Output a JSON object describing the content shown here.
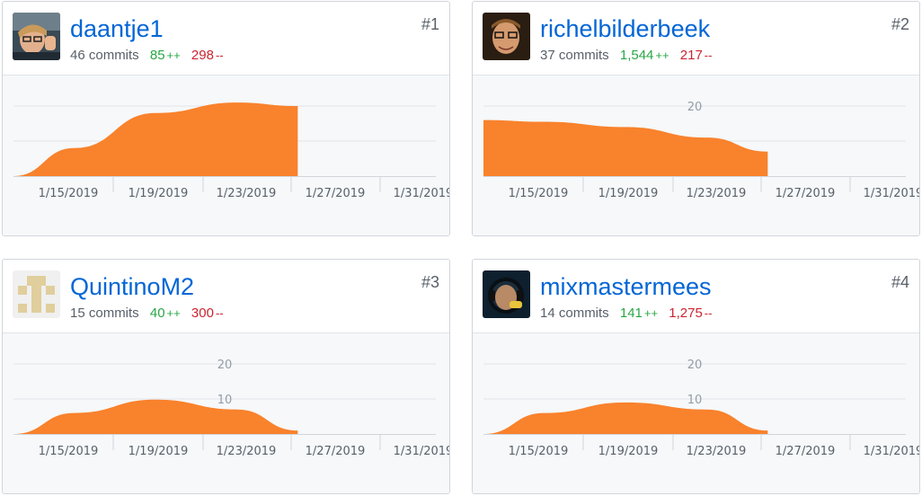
{
  "accent_color": "#f9822c",
  "x_axis_ticks": [
    "1/15/2019",
    "1/19/2019",
    "1/23/2019",
    "1/27/2019",
    "1/31/2019"
  ],
  "contributors": [
    {
      "rank": "#1",
      "username": "daantje1",
      "commits": "46 commits",
      "additions": "85",
      "deletions": "298",
      "add_suffix": "++",
      "del_suffix": "--",
      "avatar": "daantje1-avatar"
    },
    {
      "rank": "#2",
      "username": "richelbilderbeek",
      "commits": "37 commits",
      "additions": "1,544",
      "deletions": "217",
      "add_suffix": "++",
      "del_suffix": "--",
      "avatar": "richelbilderbeek-avatar"
    },
    {
      "rank": "#3",
      "username": "QuintinoM2",
      "commits": "15 commits",
      "additions": "40",
      "deletions": "300",
      "add_suffix": "++",
      "del_suffix": "--",
      "avatar": "identicon-avatar"
    },
    {
      "rank": "#4",
      "username": "mixmastermees",
      "commits": "14 commits",
      "additions": "141",
      "deletions": "1,275",
      "add_suffix": "++",
      "del_suffix": "--",
      "avatar": "mixmastermees-avatar"
    }
  ],
  "chart_data": [
    {
      "type": "area",
      "x": [
        "1/12/2019",
        "1/15/2019",
        "1/19/2019",
        "1/23/2019",
        "1/26/2019"
      ],
      "y_ticks": [],
      "values": [
        0,
        8,
        18,
        21,
        20
      ],
      "ylim": [
        0,
        20
      ],
      "xlim_days": [
        0,
        21
      ]
    },
    {
      "type": "area",
      "x": [
        "1/12/2019",
        "1/15/2019",
        "1/19/2019",
        "1/23/2019",
        "1/26/2019"
      ],
      "y_ticks": [
        20
      ],
      "values": [
        16,
        15.5,
        14,
        11,
        7
      ],
      "ylim": [
        0,
        20
      ],
      "xlim_days": [
        0,
        21
      ]
    },
    {
      "type": "area",
      "x": [
        "1/12/2019",
        "1/15/2019",
        "1/19/2019",
        "1/23/2019",
        "1/26/2019"
      ],
      "y_ticks": [
        10,
        20
      ],
      "values": [
        0,
        6,
        9.8,
        7,
        1
      ],
      "ylim": [
        0,
        20
      ],
      "xlim_days": [
        0,
        21
      ]
    },
    {
      "type": "area",
      "x": [
        "1/12/2019",
        "1/15/2019",
        "1/19/2019",
        "1/23/2019",
        "1/26/2019"
      ],
      "y_ticks": [
        10,
        20
      ],
      "values": [
        0,
        6,
        9,
        7,
        1
      ],
      "ylim": [
        0,
        20
      ],
      "xlim_days": [
        0,
        21
      ]
    }
  ]
}
